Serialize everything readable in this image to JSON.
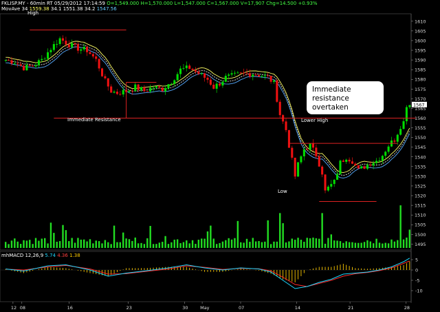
{
  "header": {
    "symbol": "FKLISP.MY",
    "interval": "60min RT",
    "date": "05/29/2012",
    "time": "17:14:59",
    "open": "O=1,549.000",
    "high": "H=1,570.000",
    "low": "L=1,547.000",
    "close": "C=1,567.000",
    "volume": "V=17,907",
    "change": "Chg=14.500",
    "change_pct": "+0.93%",
    "ma_label": "MovAve 34",
    "ma_values": [
      "1559.38",
      "34.1",
      "1551.38",
      "34.2",
      "1547.56"
    ],
    "corner_label": "High",
    "macd_label": "mhMACD 12,26,9",
    "macd_values": [
      "5.74",
      "4.36",
      "1.38"
    ]
  },
  "colors": {
    "background": "#000000",
    "bull": "#00dd00",
    "bear": "#ee1111",
    "ma": "#ffffff",
    "ma_lower": "#55aaff",
    "ma_upper": "#ffff66",
    "resistance_line": "#dd2222",
    "volume": "#22dd22",
    "macd_line": "#1cd8ff",
    "signal_line": "#ff2b2b",
    "histogram": "#ffcc00"
  },
  "annotations": {
    "immediate_resistance": "Immediate Resistance",
    "lower_high": "Lower High",
    "low": "Low",
    "callout_line1": "Immediate",
    "callout_line2": "resistance overtaken"
  },
  "chart_data": {
    "type": "candlestick",
    "x_ticks": [
      "12",
      "08",
      "16",
      "23",
      "30",
      "May",
      "07",
      "14",
      "21",
      "28"
    ],
    "price_axis": {
      "ylim": [
        1493,
        1611
      ],
      "ticks": [
        1495,
        1500,
        1505,
        1510,
        1515,
        1520,
        1525,
        1530,
        1535,
        1540,
        1545,
        1550,
        1555,
        1560,
        1565,
        1570,
        1575,
        1580,
        1585,
        1590,
        1595,
        1600,
        1605,
        1610
      ],
      "last_price": "1567"
    },
    "price_path": [
      [
        0,
        1590
      ],
      [
        3,
        1589
      ],
      [
        6,
        1586
      ],
      [
        9,
        1587
      ],
      [
        12,
        1590
      ],
      [
        15,
        1596
      ],
      [
        18,
        1601
      ],
      [
        21,
        1598
      ],
      [
        24,
        1596
      ],
      [
        27,
        1595
      ],
      [
        30,
        1590
      ],
      [
        33,
        1579
      ],
      [
        35,
        1574
      ],
      [
        37,
        1573
      ],
      [
        40,
        1574
      ],
      [
        43,
        1576
      ],
      [
        46,
        1574
      ],
      [
        49,
        1576
      ],
      [
        52,
        1575
      ],
      [
        55,
        1579
      ],
      [
        58,
        1585
      ],
      [
        61,
        1586
      ],
      [
        64,
        1583
      ],
      [
        67,
        1580
      ],
      [
        69,
        1576
      ],
      [
        71,
        1578
      ],
      [
        73,
        1581
      ],
      [
        76,
        1582
      ],
      [
        79,
        1583
      ],
      [
        82,
        1583
      ],
      [
        85,
        1582
      ],
      [
        87,
        1581
      ],
      [
        89,
        1578
      ],
      [
        91,
        1562
      ],
      [
        93,
        1554
      ],
      [
        95,
        1538
      ],
      [
        96,
        1530
      ],
      [
        97,
        1536
      ],
      [
        99,
        1544
      ],
      [
        101,
        1546
      ],
      [
        103,
        1541
      ],
      [
        105,
        1532
      ],
      [
        106,
        1522
      ],
      [
        107,
        1524
      ],
      [
        109,
        1527
      ],
      [
        111,
        1537
      ],
      [
        113,
        1540
      ],
      [
        115,
        1538
      ],
      [
        117,
        1533
      ],
      [
        119,
        1535
      ],
      [
        121,
        1537
      ],
      [
        123,
        1538
      ],
      [
        125,
        1541
      ],
      [
        127,
        1546
      ],
      [
        129,
        1549
      ],
      [
        131,
        1556
      ],
      [
        132,
        1558
      ],
      [
        133,
        1567
      ]
    ],
    "support_resistance": [
      {
        "price": 1605.5,
        "from": 8,
        "to": 40
      },
      {
        "price": 1578.5,
        "from": 40,
        "to": 50
      },
      {
        "price": 1560,
        "from": 16,
        "to": 136
      },
      {
        "price": 1547,
        "from": 94,
        "to": 130
      },
      {
        "price": 1517,
        "from": 104,
        "to": 123
      }
    ],
    "volume_axis": {
      "ticks": [
        1495,
        1500,
        1505,
        1510,
        1515
      ]
    },
    "macd": {
      "ylim": [
        -12,
        8
      ],
      "ticks": [
        5,
        0,
        -5,
        -10
      ],
      "path": [
        [
          0,
          0.5
        ],
        [
          6,
          -0.5
        ],
        [
          14,
          2
        ],
        [
          20,
          2.5
        ],
        [
          28,
          0
        ],
        [
          34,
          -3
        ],
        [
          40,
          -1.5
        ],
        [
          46,
          -0.5
        ],
        [
          54,
          1
        ],
        [
          60,
          2.5
        ],
        [
          66,
          1
        ],
        [
          72,
          0
        ],
        [
          78,
          1
        ],
        [
          84,
          0.5
        ],
        [
          88,
          -1
        ],
        [
          92,
          -5
        ],
        [
          96,
          -9
        ],
        [
          100,
          -8
        ],
        [
          104,
          -6
        ],
        [
          108,
          -4.5
        ],
        [
          112,
          -2
        ],
        [
          116,
          -1.5
        ],
        [
          120,
          -1
        ],
        [
          124,
          0
        ],
        [
          128,
          1.5
        ],
        [
          132,
          4
        ],
        [
          134,
          5.74
        ]
      ],
      "signal": [
        [
          0,
          0.4
        ],
        [
          6,
          0
        ],
        [
          14,
          1.5
        ],
        [
          20,
          2.2
        ],
        [
          28,
          0.5
        ],
        [
          34,
          -2
        ],
        [
          40,
          -1.8
        ],
        [
          46,
          -0.8
        ],
        [
          54,
          0.5
        ],
        [
          60,
          2
        ],
        [
          66,
          1.3
        ],
        [
          72,
          0.3
        ],
        [
          78,
          0.8
        ],
        [
          84,
          0.6
        ],
        [
          88,
          -0.4
        ],
        [
          92,
          -3.5
        ],
        [
          96,
          -7
        ],
        [
          100,
          -8
        ],
        [
          104,
          -6.5
        ],
        [
          108,
          -5
        ],
        [
          112,
          -3
        ],
        [
          116,
          -1.8
        ],
        [
          120,
          -1.2
        ],
        [
          124,
          -0.3
        ],
        [
          128,
          1
        ],
        [
          132,
          3.2
        ],
        [
          134,
          4.36
        ]
      ]
    }
  }
}
